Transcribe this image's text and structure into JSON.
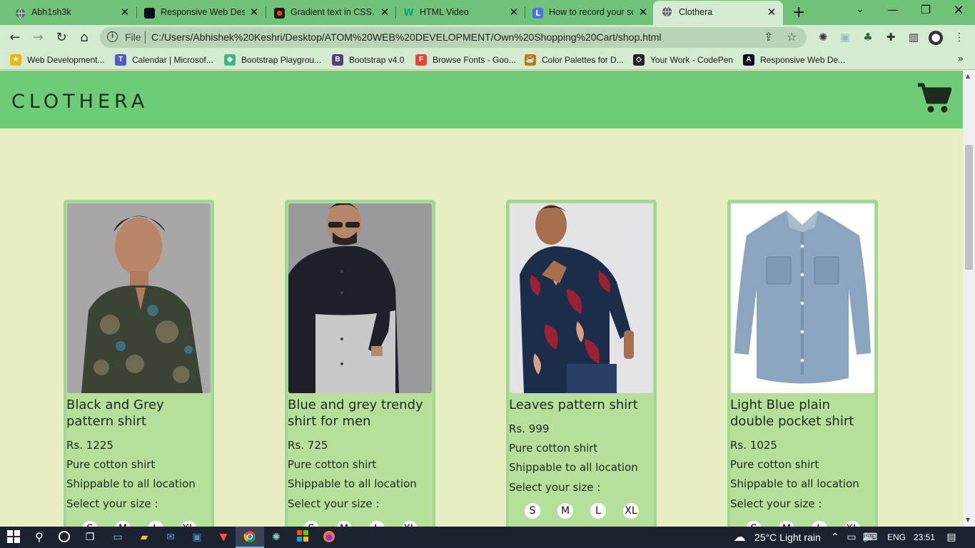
{
  "browser": {
    "tabs": [
      {
        "label": "Abh1sh3k",
        "favicon": "globe-icon",
        "color": "#5f6368"
      },
      {
        "label": "Responsive Web Desig",
        "favicon": "freecodecamp-icon",
        "color": "#0a0a23"
      },
      {
        "label": "Gradient text in CSS. A",
        "favicon": "codepen-orange-icon",
        "color": "#e8430a"
      },
      {
        "label": "HTML Video",
        "favicon": "w3schools-icon",
        "color": "#04aa6d"
      },
      {
        "label": "How to record your sc",
        "favicon": "loom-icon",
        "color": "#4c6ef5"
      },
      {
        "label": "Clothera",
        "favicon": "globe-icon",
        "color": "#5f6368"
      }
    ],
    "active_tab": "Clothera",
    "address": {
      "scheme_label": "File",
      "url": "C:/Users/Abhishek%20Keshri/Desktop/ATOM%20WEB%20DEVELOPMENT/Own%20Shopping%20Cart/shop.html"
    },
    "bookmarks": [
      {
        "label": "Web Development...",
        "icon": "bookmark-web-icon",
        "color": "#f4b400",
        "glyph": "★"
      },
      {
        "label": "Calendar | Microsof...",
        "icon": "teams-icon",
        "color": "#5059c9",
        "glyph": "T"
      },
      {
        "label": "Bootstrap Playgrou...",
        "icon": "playground-icon",
        "color": "#41b883",
        "glyph": "◆"
      },
      {
        "label": "Bootstrap v4.0",
        "icon": "bootstrap-icon",
        "color": "#563d7c",
        "glyph": "B"
      },
      {
        "label": "Browse Fonts - Goo...",
        "icon": "google-fonts-icon",
        "color": "#ea4335",
        "glyph": "F"
      },
      {
        "label": "Color Palettes for D...",
        "icon": "palette-icon",
        "color": "#c47a00",
        "glyph": "☕"
      },
      {
        "label": "Your Work - CodePen",
        "icon": "codepen-icon",
        "color": "#222222",
        "glyph": "◇"
      },
      {
        "label": "Responsive Web De...",
        "icon": "freecodecamp-icon",
        "color": "#0a0a23",
        "glyph": "A"
      }
    ]
  },
  "site": {
    "brand": "CLOTHERA",
    "header_color": "#6ecb77",
    "background": "#e8eec2",
    "card_color": "#b6e09a"
  },
  "products": [
    {
      "name": "Black and Grey pattern shirt",
      "price": "Rs. 1225",
      "material": "Pure cotton shirt",
      "shipping": "Shippable to all location",
      "size_prompt": "Select your size :",
      "sizes": [
        "S",
        "M",
        "L",
        "XL"
      ]
    },
    {
      "name": "Blue and grey trendy shirt for men",
      "price": "Rs. 725",
      "material": "Pure cotton shirt",
      "shipping": "Shippable to all location",
      "size_prompt": "Select your size :",
      "sizes": [
        "S",
        "M",
        "L",
        "XL"
      ]
    },
    {
      "name": "Leaves pattern shirt",
      "price": "Rs. 999",
      "material": "Pure cotton shirt",
      "shipping": "Shippable to all location",
      "size_prompt": "Select your size :",
      "sizes": [
        "S",
        "M",
        "L",
        "XL"
      ]
    },
    {
      "name": "Light Blue plain double pocket shirt",
      "price": "Rs. 1025",
      "material": "Pure cotton shirt",
      "shipping": "Shippable to all location",
      "size_prompt": "Select your size :",
      "sizes": [
        "S",
        "M",
        "L",
        "XL"
      ]
    }
  ],
  "taskbar": {
    "weather": "25°C  Light rain",
    "language": "ENG",
    "time": "23:51"
  }
}
